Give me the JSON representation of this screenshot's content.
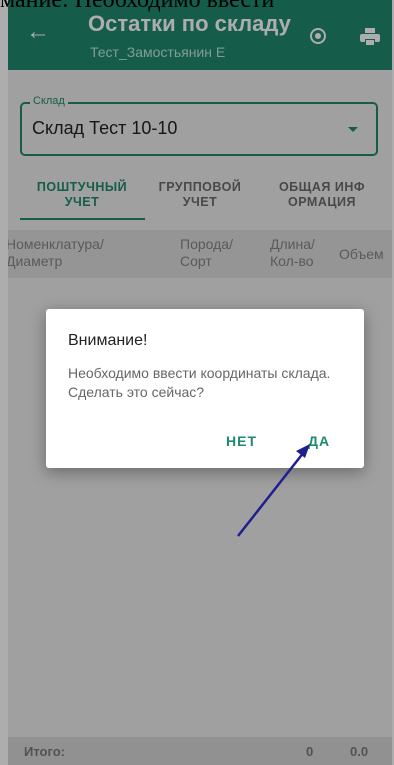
{
  "top_caption": "мание: Необходимо ввести",
  "app_bar": {
    "title": "Остатки по складу",
    "subtitle": "Тест_Замостьянин Е",
    "back_icon": "arrow-left-icon",
    "locate_icon": "my-location-icon",
    "print_icon": "print-icon"
  },
  "warehouse_field": {
    "label": "Склад",
    "value": "Склад Тест 10-10",
    "dropdown_icon": "chevron-down-icon"
  },
  "tabs": [
    {
      "line1": "ПОШТУЧНЫЙ",
      "line2": "УЧЕТ",
      "active": true
    },
    {
      "line1": "ГРУППОВОЙ",
      "line2": "УЧЕТ",
      "active": false
    },
    {
      "line1": "ОБЩАЯ ИНФ",
      "line2": "ОРМАЦИЯ",
      "active": false
    }
  ],
  "table_header": [
    {
      "line1": "Номенклатура/",
      "line2": "Диаметр"
    },
    {
      "line1": "Порода/",
      "line2": "Сорт"
    },
    {
      "line1": "Длина/",
      "line2": "Кол-во"
    },
    {
      "line1": "Объем",
      "line2": ""
    }
  ],
  "totals": {
    "label": "Итого:",
    "count": "0",
    "volume": "0.0"
  },
  "dialog": {
    "title": "Внимание!",
    "message": "Необходимо ввести координаты склада. Сделать это сейчас?",
    "no_label": "НЕТ",
    "yes_label": "ДА"
  },
  "colors": {
    "primary": "#1f8a6d",
    "annotation_arrow": "#1f1f8f"
  }
}
